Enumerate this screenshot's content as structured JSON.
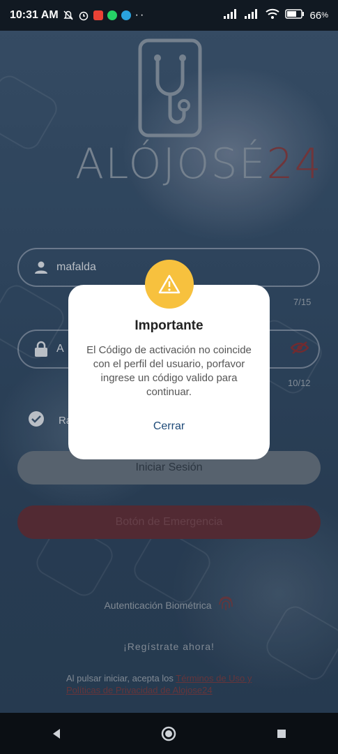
{
  "status_bar": {
    "time": "10:31 AM",
    "battery": "66"
  },
  "logo": {
    "brand_text": "ALÓJOSÉ",
    "brand_number": "24"
  },
  "form": {
    "username_value": "mafalda",
    "username_counter": "7/15",
    "password_value": "A",
    "password_counter": "10/12",
    "remember_label": "Ra",
    "login_button": "Iniciar Sesión",
    "emergency_button": "Botón de Emergencia",
    "biometric_label": "Autenticación Biométrica",
    "register_link": "¡Regístrate ahora!",
    "terms_prefix": "Al pulsar iniciar, acepta los ",
    "terms_link": "Términos de Uso y Políticas de Privacidad de Alojose24"
  },
  "dialog": {
    "title": "Importante",
    "message": "El Código de activación no coincide con el perfil del usuario, porfavor ingrese un código valido para continuar.",
    "close_button": "Cerrar"
  },
  "colors": {
    "dialog_icon_bg": "#f7c13e",
    "close_link": "#1e4a78",
    "emergency": "#5a2e38"
  },
  "icons": {
    "warning": "warning-icon",
    "user": "user-icon",
    "lock": "lock-icon",
    "eye": "eye-icon",
    "check": "check-icon",
    "fingerprint": "fingerprint-icon"
  }
}
